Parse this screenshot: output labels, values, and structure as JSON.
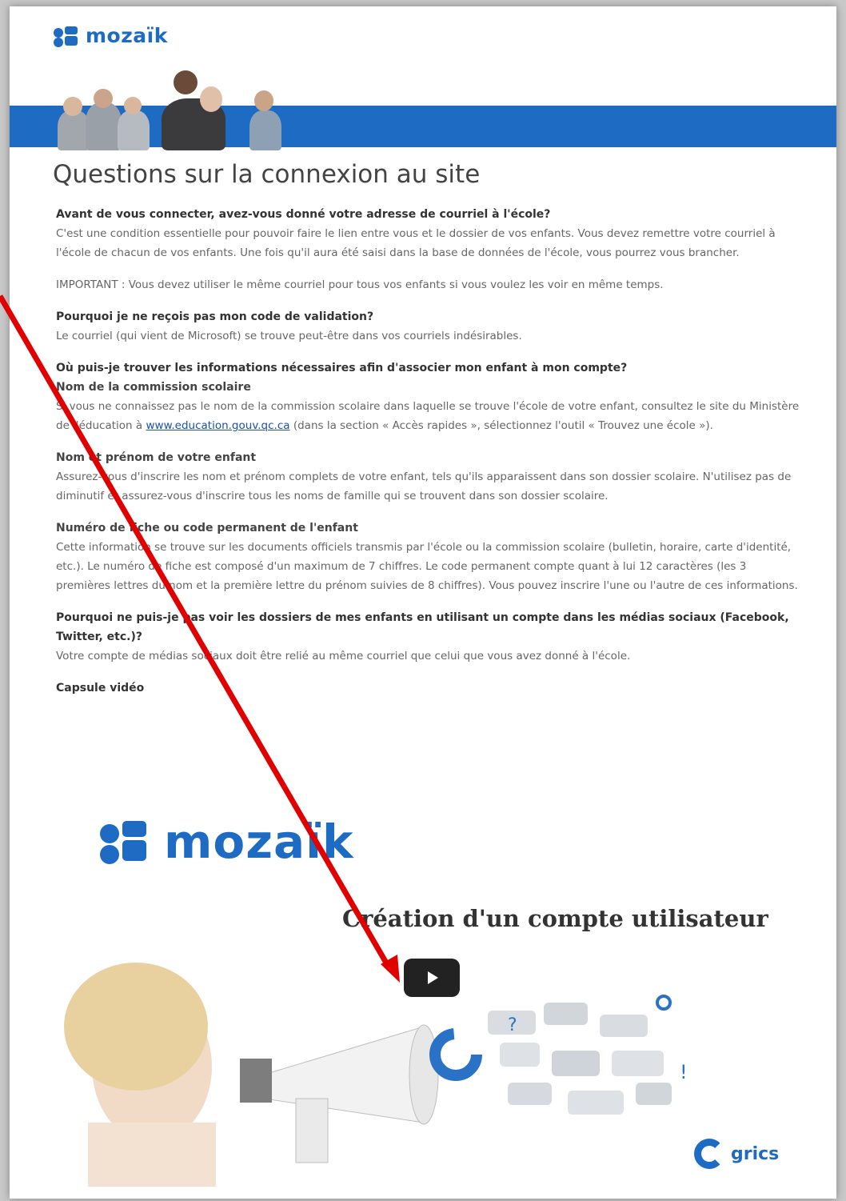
{
  "header": {
    "logo_text": "mozaïk"
  },
  "page_title": "Questions sur la connexion au site",
  "sections": {
    "s1_q": "Avant de vous connecter, avez-vous donné votre adresse de courriel à l'école?",
    "s1_p1": "C'est une condition essentielle pour pouvoir faire le lien entre vous et le dossier de vos enfants. Vous devez remettre votre courriel à l'école de chacun de vos enfants. Une fois qu'il aura été saisi dans la base de données de l'école, vous pourrez vous brancher.",
    "s1_p2": "IMPORTANT : Vous devez utiliser le même courriel pour tous vos enfants si vous voulez les voir en même temps.",
    "s2_q": "Pourquoi je ne reçois pas mon code de validation?",
    "s2_p": "Le courriel (qui vient de Microsoft) se trouve peut-être dans vos courriels indésirables.",
    "s3_q": "Où puis-je trouver les informations nécessaires afin d'associer mon enfant à mon compte?",
    "s3_sub1": "Nom de la commission scolaire",
    "s3_p1a": "Si vous ne connaissez pas le nom de la commission scolaire dans laquelle se trouve l'école de votre enfant, consultez le site du Ministère de l'éducation à ",
    "s3_link": "www.education.gouv.qc.ca",
    "s3_p1b": " (dans la section « Accès rapides », sélectionnez l'outil « Trouvez une école »).",
    "s3_sub2": "Nom et prénom de votre enfant",
    "s3_p2": "Assurez-vous d'inscrire les nom et prénom complets de votre enfant, tels qu'ils apparaissent dans son dossier scolaire. N'utilisez pas de diminutif et assurez-vous d'inscrire tous les noms de famille qui se trouvent dans son dossier scolaire.",
    "s3_sub3": "Numéro de fiche ou code permanent de l'enfant",
    "s3_p3": "Cette information se trouve sur les documents officiels transmis par l'école ou la commission scolaire (bulletin, horaire, carte d'identité, etc.). Le numéro de fiche est composé d'un maximum de 7 chiffres. Le code permanent compte quant à lui 12 caractères (les 3 premières lettres du nom et la première lettre du prénom suivies de 8 chiffres). Vous pouvez inscrire l'une ou l'autre de ces informations.",
    "s4_q": "Pourquoi ne puis-je pas voir les dossiers de mes enfants en utilisant un compte dans les médias sociaux (Facebook, Twitter, etc.)?",
    "s4_p": "Votre compte de médias sociaux doit être relié au même courriel que celui que vous avez donné à l'école.",
    "s5_q": "Capsule vidéo"
  },
  "video": {
    "logo_text": "mozaïk",
    "title": "Création d'un compte utilisateur",
    "grics_text": "grics",
    "play_icon": "play-icon"
  },
  "colors": {
    "brand": "#1e6bc4",
    "arrow": "#e00000"
  }
}
